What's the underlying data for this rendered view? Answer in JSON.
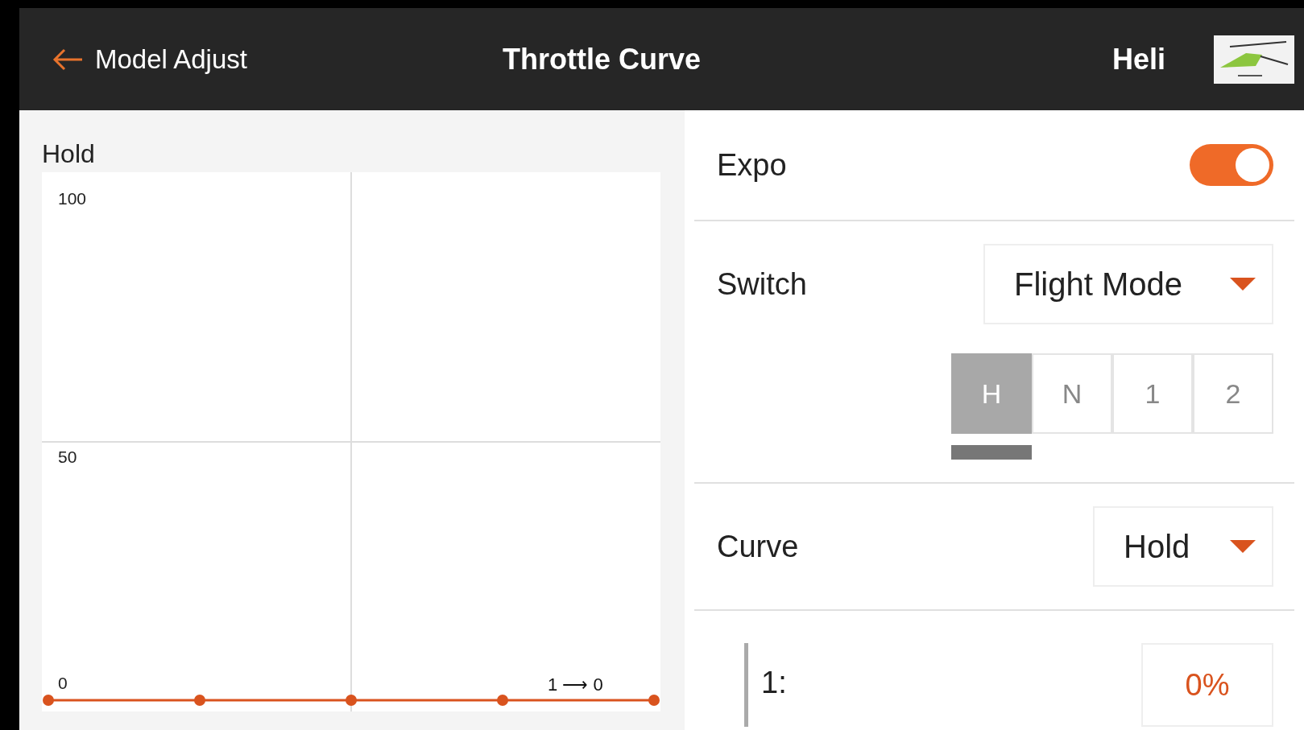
{
  "header": {
    "back_label": "Model Adjust",
    "title": "Throttle Curve",
    "model_type": "Heli"
  },
  "curve_panel": {
    "label": "Hold",
    "point_readout": "1 ⟶ 0",
    "y_axis_labels": [
      "100",
      "50",
      "0"
    ]
  },
  "settings": {
    "expo": {
      "label": "Expo",
      "on": true
    },
    "switch": {
      "label": "Switch",
      "value": "Flight Mode"
    },
    "modes": [
      {
        "label": "H",
        "selected": true
      },
      {
        "label": "N",
        "selected": false
      },
      {
        "label": "1",
        "selected": false
      },
      {
        "label": "2",
        "selected": false
      }
    ],
    "curve": {
      "label": "Curve",
      "value": "Hold"
    },
    "point": {
      "label": "1:",
      "value": "0%"
    }
  }
}
